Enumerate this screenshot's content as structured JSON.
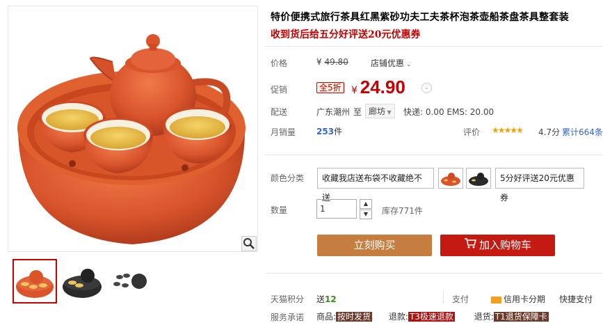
{
  "product": {
    "title": "特价便携式旅行茶具红黑紫砂功夫工夫茶杯泡茶壶船茶盘茶具整套装",
    "subtitle": "收到货后给五分好评送20元优惠券"
  },
  "price": {
    "label": "价格",
    "currency": "¥",
    "original": "49.80",
    "shop_discount": "店铺优惠"
  },
  "promo": {
    "label": "促销",
    "badge": "全5折",
    "currency": "¥",
    "price": "24.90"
  },
  "delivery": {
    "label": "配送",
    "from": "广东潮州",
    "to_word": "至",
    "to": "廊坊",
    "fees": "快递: 0.00 EMS: 20.00"
  },
  "sales": {
    "label": "月销量",
    "count": "253",
    "unit": "件",
    "rating_label": "评价",
    "stars": "★★★★★",
    "score": "4.7分",
    "reviews": "累计664条"
  },
  "sku": {
    "label": "颜色分类",
    "options": [
      "收藏我店送布袋不收藏绝不送",
      "5分好评送20元优惠券"
    ]
  },
  "quantity": {
    "label": "数量",
    "value": "1",
    "stock": "库存771件"
  },
  "buttons": {
    "buy_now": "立刻购买",
    "add_cart": "加入购物车"
  },
  "footer": {
    "points_label": "天猫积分",
    "points_prefix": "送",
    "points_value": "12",
    "pay_label": "支付",
    "credit": "信用卡分期",
    "fast_pay": "快捷支付",
    "service_label": "服务承诺",
    "goods": "商品:",
    "goods_tag": "按时发货",
    "refund": "退款:",
    "refund_tag": "T3极速退款",
    "return": "退货:",
    "return_tag": "T1退货保障卡"
  },
  "colors": {
    "accent_red": "#c40000",
    "buy_button": "#c57e3f",
    "cart_button": "#c41a12",
    "star": "#f2a10a"
  }
}
